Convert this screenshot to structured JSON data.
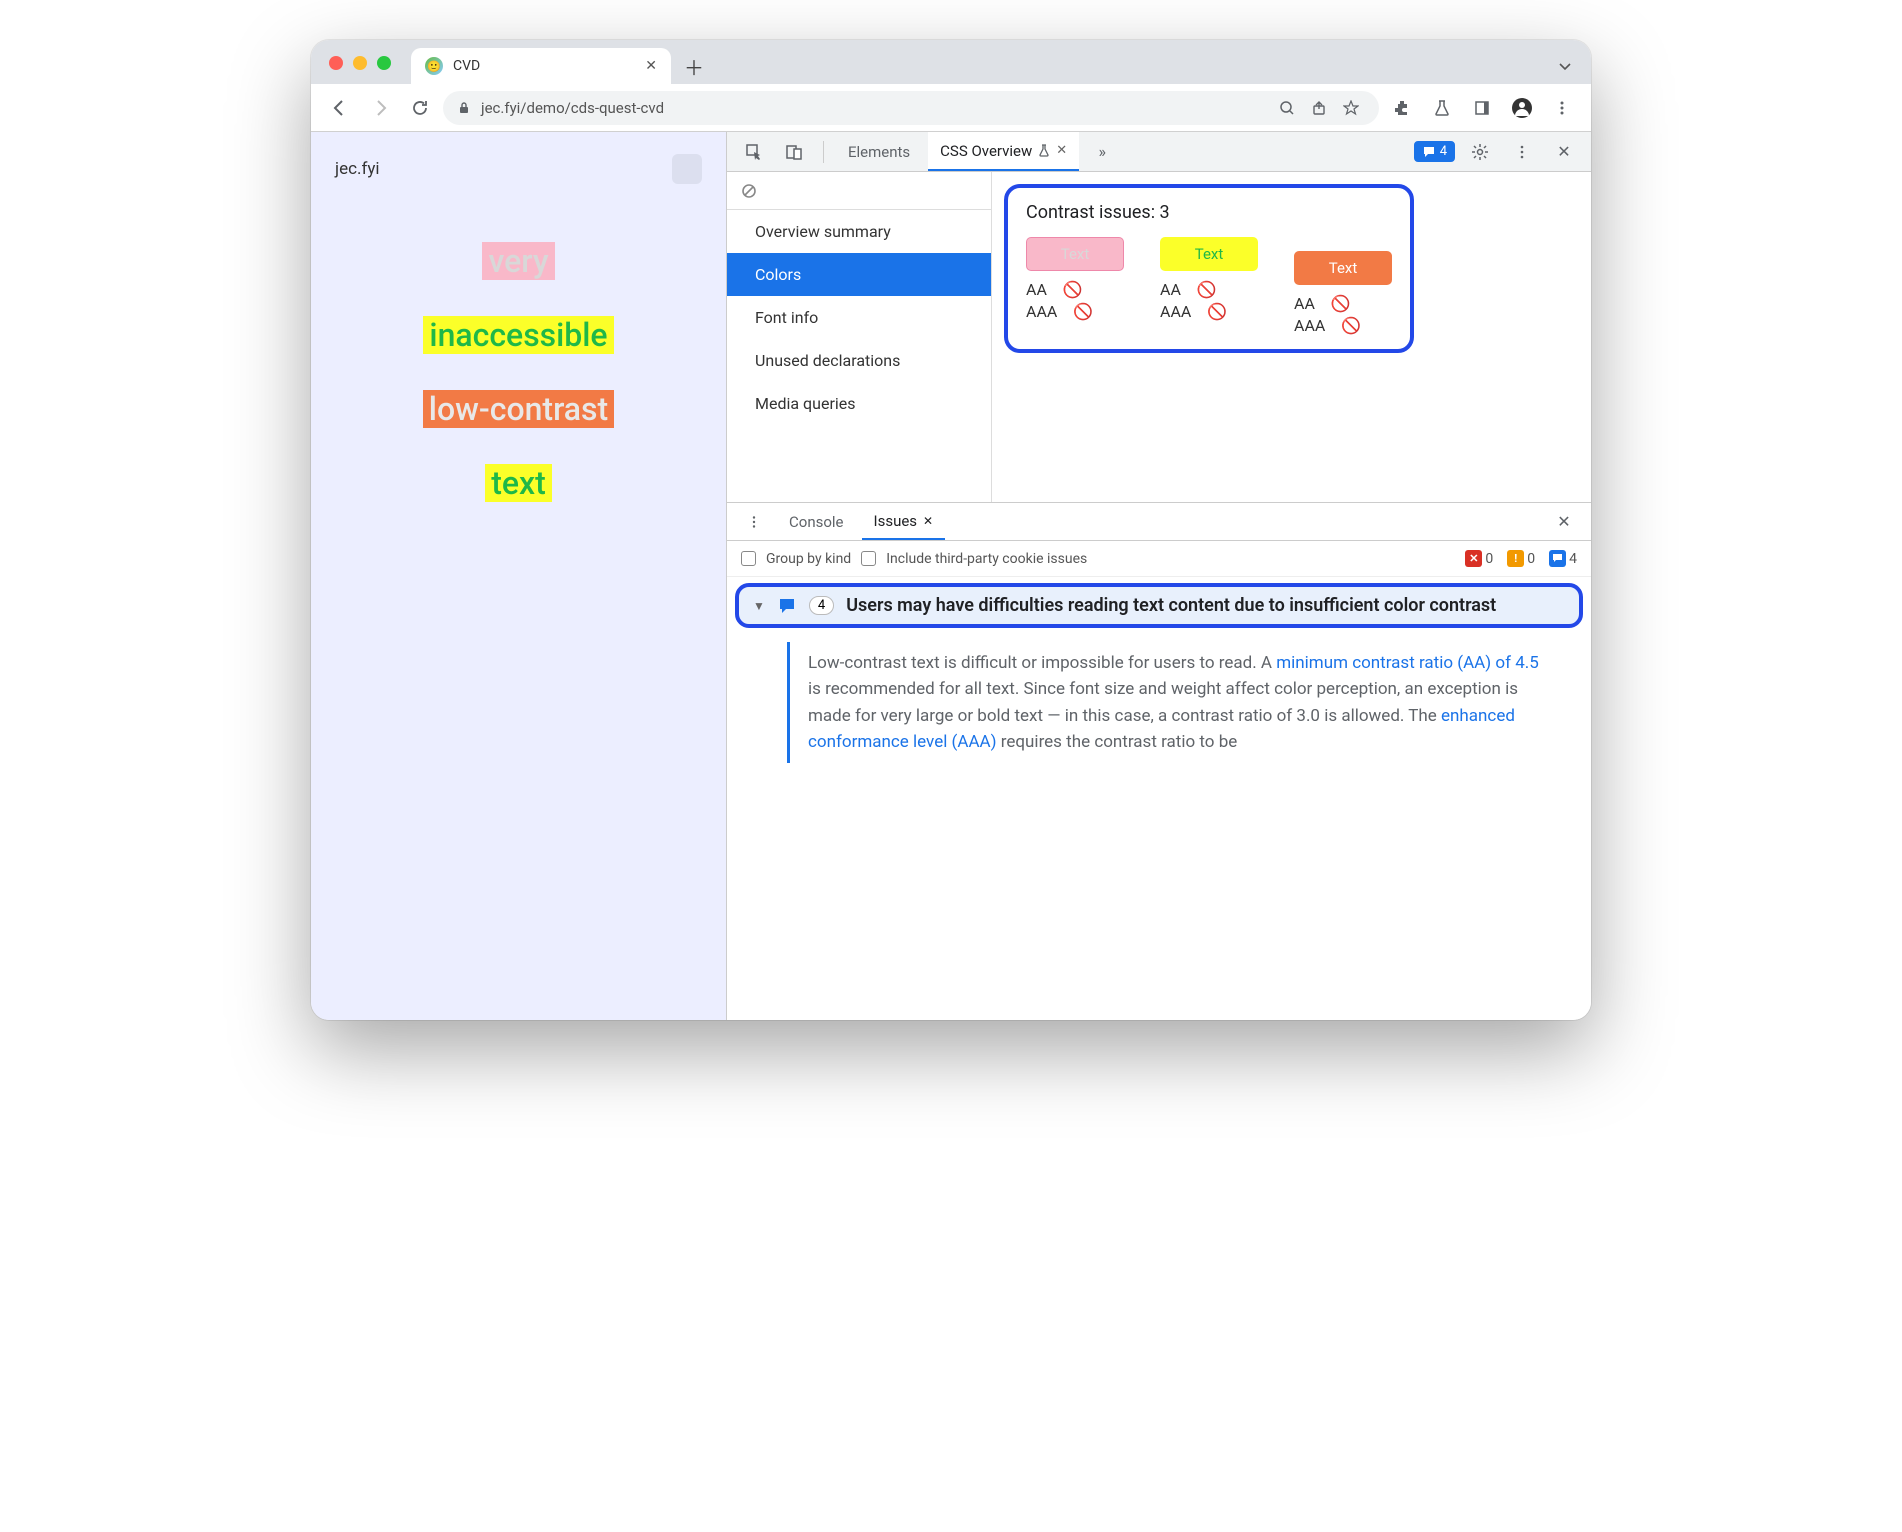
{
  "browser": {
    "tab_title": "CVD",
    "url_display": "jec.fyi/demo/cds-quest-cvd"
  },
  "page": {
    "brand": "jec.fyi",
    "samples": [
      "very",
      "inaccessible",
      "low-contrast",
      "text"
    ]
  },
  "devtools": {
    "tabs": {
      "elements": "Elements",
      "css_overview": "CSS Overview"
    },
    "issues_count": "4",
    "sidebar": {
      "items": [
        "Overview summary",
        "Colors",
        "Font info",
        "Unused declarations",
        "Media queries"
      ]
    },
    "contrast": {
      "title": "Contrast issues: 3",
      "swatch_label": "Text",
      "aa": "AA",
      "aaa": "AAA"
    }
  },
  "drawer": {
    "tabs": {
      "console": "Console",
      "issues": "Issues"
    },
    "filters": {
      "group": "Group by kind",
      "third_party": "Include third-party cookie issues"
    },
    "counts": {
      "errors": "0",
      "warnings": "0",
      "info": "4"
    },
    "issue": {
      "count": "4",
      "title": "Users may have difficulties reading text content due to insufficient color contrast",
      "body_pre": "Low-contrast text is difficult or impossible for users to read. A ",
      "link1": "minimum contrast ratio (AA) of 4.5",
      "body_mid": " is recommended for all text. Since font size and weight affect color perception, an exception is made for very large or bold text — in this case, a contrast ratio of 3.0 is allowed. The ",
      "link2": "enhanced conformance level (AAA)",
      "body_post": " requires the contrast ratio to be"
    }
  }
}
